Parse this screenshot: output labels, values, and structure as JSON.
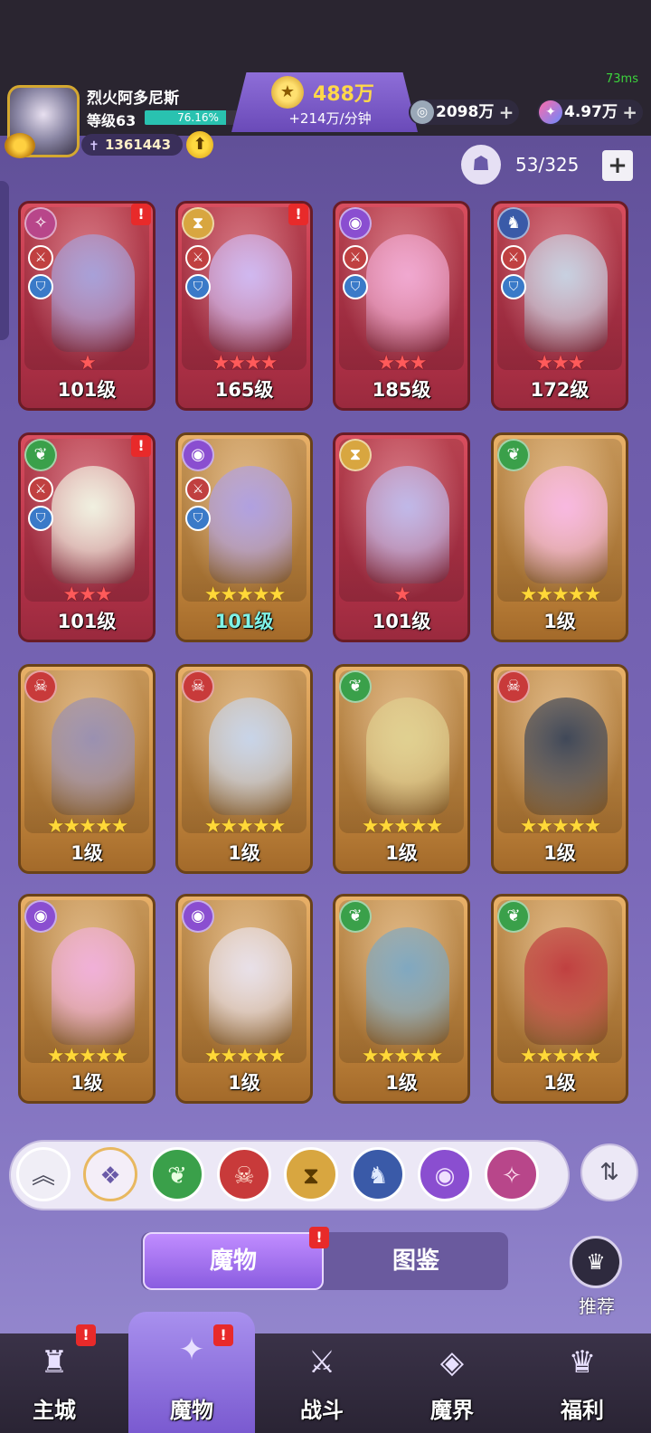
{
  "status": {
    "ping": "73ms"
  },
  "player": {
    "name": "烈火阿多尼斯",
    "level_label": "等级63",
    "xp_percent_text": "76.16%",
    "xp_fraction": 0.7616,
    "power": "1361443"
  },
  "gold": {
    "amount": "488万",
    "rate": "+214万/分钟"
  },
  "currencies": [
    {
      "name": "silver-coin",
      "amount": "2098万"
    },
    {
      "name": "crystal-gem",
      "amount": "4.97万"
    }
  ],
  "capacity": {
    "text": "53/325"
  },
  "cards": [
    {
      "frame": "red",
      "faction": "wind",
      "stars": 1,
      "level": "101级",
      "alert": true,
      "badges": [
        "red",
        "blue"
      ]
    },
    {
      "frame": "red",
      "faction": "time",
      "stars": 4,
      "level": "165级",
      "alert": true,
      "badges": [
        "red",
        "blue"
      ]
    },
    {
      "frame": "red",
      "faction": "eye",
      "stars": 3,
      "level": "185级",
      "alert": false,
      "badges": [
        "red",
        "blue"
      ]
    },
    {
      "frame": "red",
      "faction": "dragon",
      "stars": 3,
      "level": "172级",
      "alert": false,
      "badges": [
        "red",
        "blue"
      ]
    },
    {
      "frame": "red",
      "faction": "leaf",
      "stars": 3,
      "level": "101级",
      "alert": true,
      "badges": [
        "red",
        "blue"
      ]
    },
    {
      "frame": "gold",
      "faction": "eye",
      "stars": 5,
      "level": "101级",
      "alert": false,
      "badges": [
        "red",
        "blue"
      ],
      "level_color": "cyan"
    },
    {
      "frame": "red",
      "faction": "time",
      "stars": 1,
      "level": "101级",
      "alert": false,
      "badges": []
    },
    {
      "frame": "gold",
      "faction": "leaf",
      "stars": 5,
      "level": "1级",
      "alert": false,
      "badges": []
    },
    {
      "frame": "gold",
      "faction": "demon",
      "stars": 5,
      "level": "1级",
      "alert": false,
      "badges": []
    },
    {
      "frame": "gold",
      "faction": "demon",
      "stars": 5,
      "level": "1级",
      "alert": false,
      "badges": []
    },
    {
      "frame": "gold",
      "faction": "leaf",
      "stars": 5,
      "level": "1级",
      "alert": false,
      "badges": []
    },
    {
      "frame": "gold",
      "faction": "demon",
      "stars": 5,
      "level": "1级",
      "alert": false,
      "badges": []
    },
    {
      "frame": "gold",
      "faction": "eye",
      "stars": 5,
      "level": "1级",
      "alert": false,
      "badges": []
    },
    {
      "frame": "gold",
      "faction": "eye",
      "stars": 5,
      "level": "1级",
      "alert": false,
      "badges": []
    },
    {
      "frame": "gold",
      "faction": "leaf",
      "stars": 5,
      "level": "1级",
      "alert": false,
      "badges": []
    },
    {
      "frame": "gold",
      "faction": "leaf",
      "stars": 5,
      "level": "1级",
      "alert": false,
      "badges": []
    }
  ],
  "filters": [
    {
      "name": "collapse",
      "icon": "double-chevron-up-icon"
    },
    {
      "name": "all",
      "icon": "diamond-grid-icon",
      "selected": true
    },
    {
      "name": "leaf",
      "icon": "leaf-icon"
    },
    {
      "name": "demon",
      "icon": "demon-mask-icon"
    },
    {
      "name": "time",
      "icon": "hourglass-icon"
    },
    {
      "name": "dragon",
      "icon": "dragon-icon"
    },
    {
      "name": "eye",
      "icon": "eye-icon"
    },
    {
      "name": "wind",
      "icon": "wind-icon"
    }
  ],
  "tabs": {
    "active": "魔物",
    "inactive": "图鉴"
  },
  "recommend": {
    "label": "推荐"
  },
  "nav": [
    {
      "label": "主城",
      "icon": "castle-icon",
      "alert": true
    },
    {
      "label": "魔物",
      "icon": "flame-icon",
      "alert": true,
      "active": true
    },
    {
      "label": "战斗",
      "icon": "sword-shield-icon",
      "alert": false
    },
    {
      "label": "魔界",
      "icon": "portal-icon",
      "alert": false
    },
    {
      "label": "福利",
      "icon": "chest-icon",
      "alert": false
    }
  ],
  "colors": {
    "frame_red": "#d84e5e",
    "frame_gold": "#e8b068",
    "accent_purple": "#8a5ce0",
    "alert_red": "#e82a2a"
  }
}
